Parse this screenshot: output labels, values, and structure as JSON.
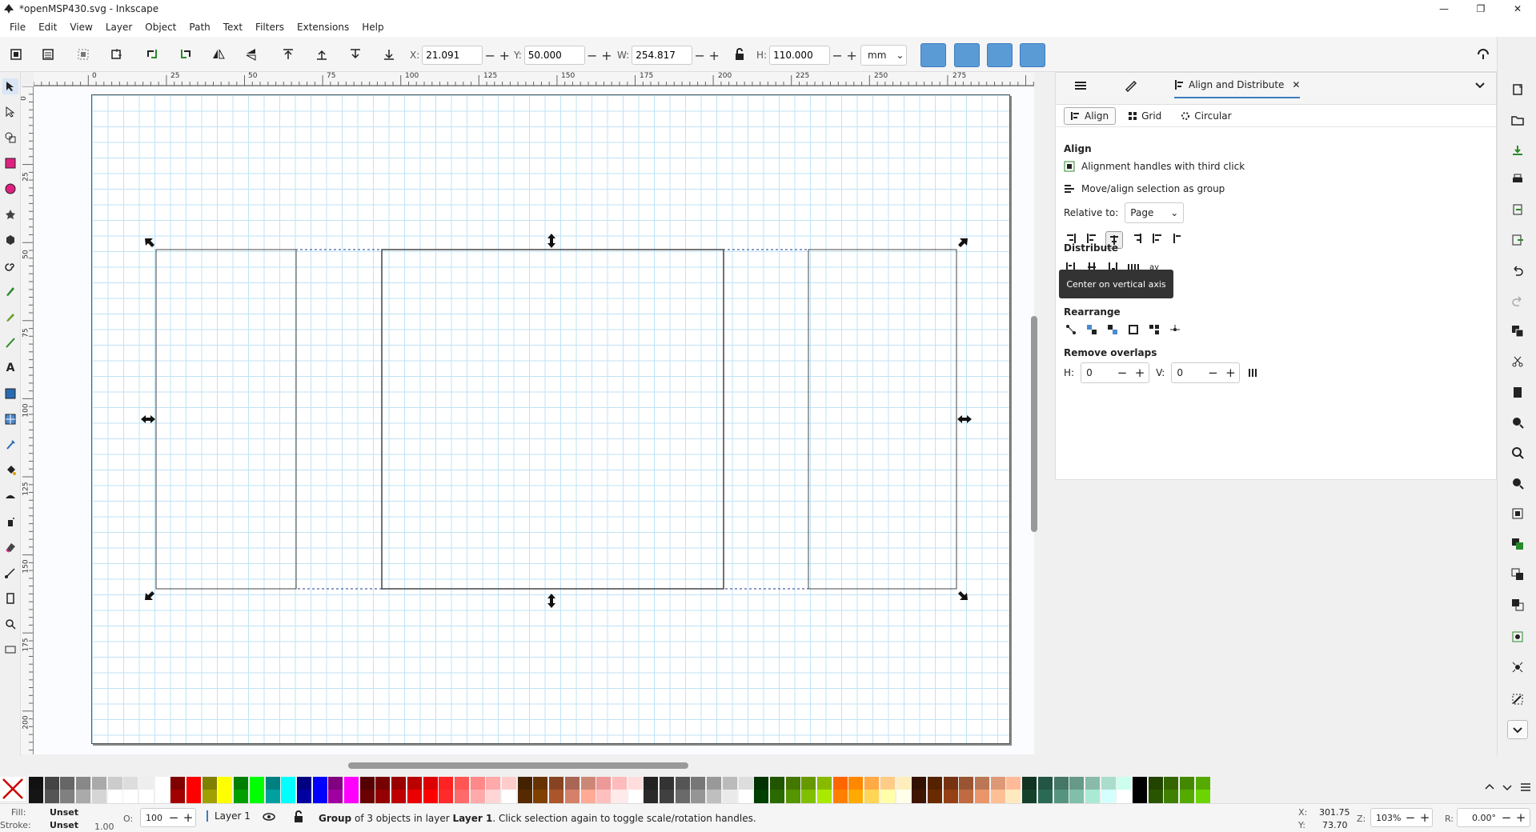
{
  "window": {
    "title": "*openMSP430.svg - Inkscape",
    "buttons": [
      "—",
      "❐",
      "✕"
    ]
  },
  "menu": [
    "File",
    "Edit",
    "View",
    "Layer",
    "Object",
    "Path",
    "Text",
    "Filters",
    "Extensions",
    "Help"
  ],
  "toolbar": {
    "x_label": "X:",
    "x_value": "21.091",
    "y_label": "Y:",
    "y_value": "50.000",
    "w_label": "W:",
    "w_value": "254.817",
    "h_label": "H:",
    "h_value": "110.000",
    "unit": "mm",
    "minus": "−",
    "plus": "+"
  },
  "rulers": {
    "horizontal": [
      "0",
      "25",
      "50",
      "75",
      "100",
      "125",
      "150",
      "175",
      "200",
      "225",
      "250",
      "275"
    ],
    "vertical": [
      "0",
      "25",
      "50",
      "75",
      "100",
      "125",
      "150",
      "175",
      "200"
    ]
  },
  "dock": {
    "tab_active": "Align and Distribute",
    "subtabs": [
      "Align",
      "Grid",
      "Circular"
    ],
    "align_title": "Align",
    "opt_third_click": "Alignment handles with third click",
    "opt_group": "Move/align selection as group",
    "relative_label": "Relative to:",
    "relative_value": "Page",
    "tooltip": "Center on vertical axis",
    "distribute_title": "Distribute",
    "rearrange_title": "Rearrange",
    "overlap_title": "Remove overlaps",
    "h_label": "H:",
    "h_value": "0",
    "v_label": "V:",
    "v_value": "0"
  },
  "status": {
    "fill_label": "Fill:",
    "fill_value": "Unset",
    "stroke_label": "Stroke:",
    "stroke_value": "Unset",
    "stroke_width": "1.00",
    "opacity_label": "O:",
    "opacity_value": "100",
    "layer": "Layer 1",
    "message_strong": "Group",
    "message_mid": " of 3 objects in layer ",
    "message_layer": "Layer 1",
    "message_end": ". Click selection again to toggle scale/rotation handles.",
    "x_label": "X:",
    "x_value": "301.75",
    "y_label": "Y:",
    "y_value": "73.70",
    "zoom_label": "Z:",
    "zoom_value": "103%",
    "rot_label": "R:",
    "rot_value": "0.00°"
  },
  "colors": {
    "accent": "#5b9bd5",
    "grid": "#bfe3f5",
    "selection": "#1a3a8f"
  }
}
